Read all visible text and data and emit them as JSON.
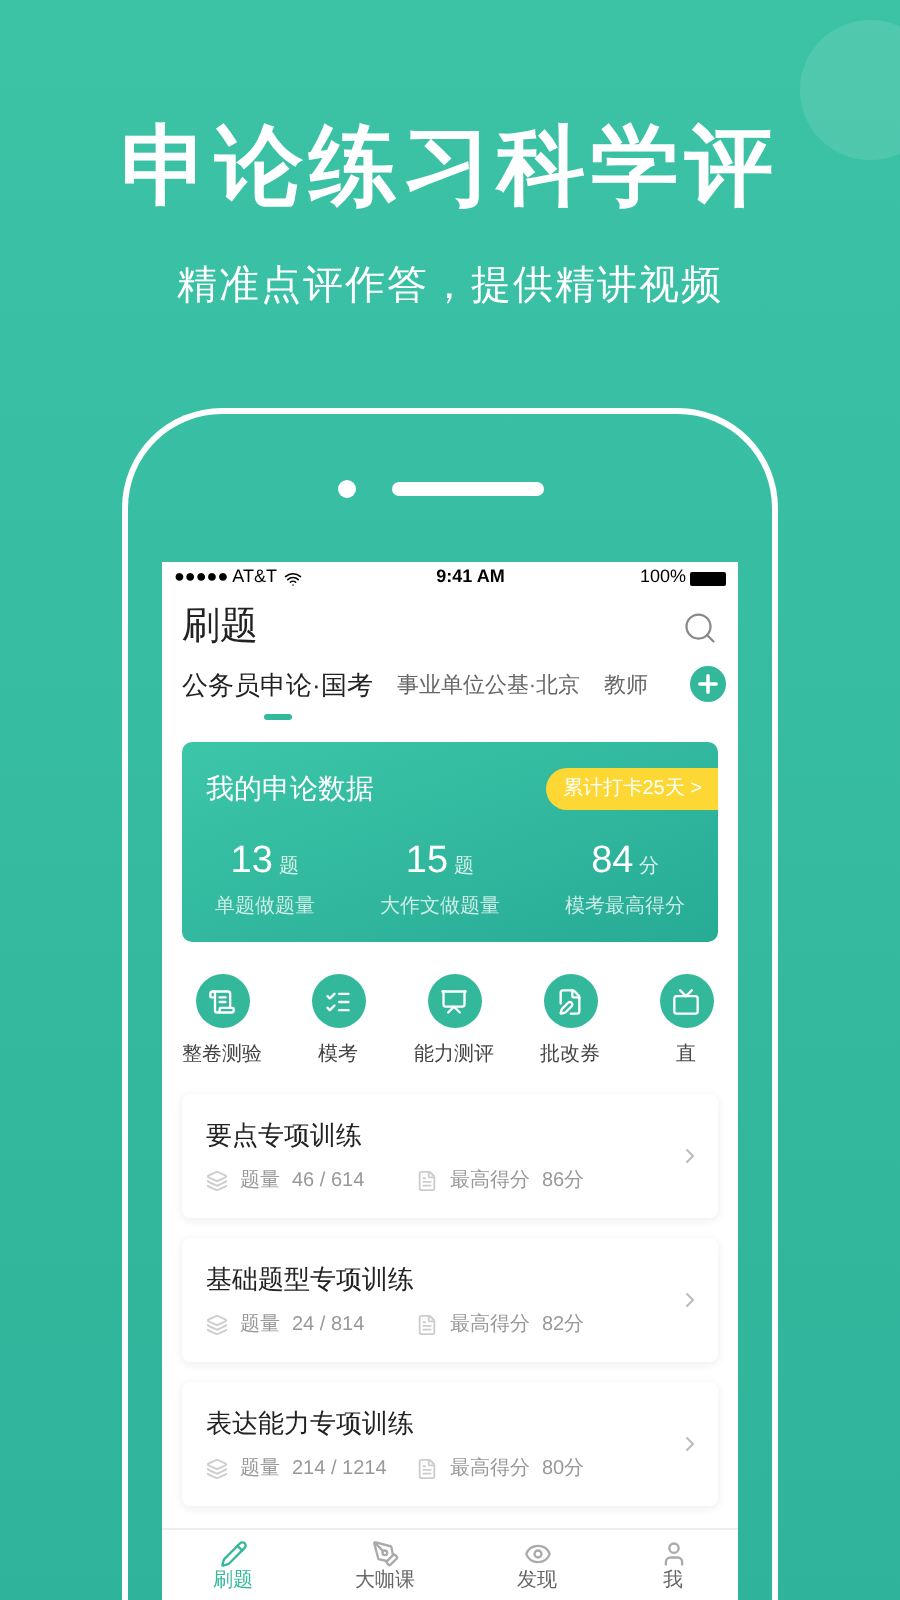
{
  "headline": "申论练习科学评",
  "subtitle": "精准点评作答，提供精讲视频",
  "status_bar": {
    "carrier": "●●●●● AT&T",
    "time": "9:41 AM",
    "battery": "100%"
  },
  "page_title": "刷题",
  "tabs": [
    {
      "label": "公务员申论·国考",
      "selected": true
    },
    {
      "label": "事业单位公基·北京",
      "selected": false
    },
    {
      "label": "教师",
      "selected": false
    }
  ],
  "data_card": {
    "title": "我的申论数据",
    "badge": "累计打卡25天 >",
    "stats": [
      {
        "value": "13",
        "unit": "题",
        "label": "单题做题量"
      },
      {
        "value": "15",
        "unit": "题",
        "label": "大作文做题量"
      },
      {
        "value": "84",
        "unit": "分",
        "label": "模考最高得分"
      }
    ]
  },
  "shortcuts": [
    {
      "label": "整卷测验"
    },
    {
      "label": "模考"
    },
    {
      "label": "能力测评"
    },
    {
      "label": "批改券"
    },
    {
      "label": "直"
    }
  ],
  "courses": [
    {
      "title": "要点专项训练",
      "count_label": "题量",
      "count": "46 / 614",
      "score_label": "最高得分",
      "score": "86分"
    },
    {
      "title": "基础题型专项训练",
      "count_label": "题量",
      "count": "24 / 814",
      "score_label": "最高得分",
      "score": "82分"
    },
    {
      "title": "表达能力专项训练",
      "count_label": "题量",
      "count": "214 / 1214",
      "score_label": "最高得分",
      "score": "80分"
    }
  ],
  "bottom_nav": [
    {
      "label": "刷题",
      "selected": true
    },
    {
      "label": "大咖课",
      "selected": false
    },
    {
      "label": "发现",
      "selected": false
    },
    {
      "label": "我",
      "selected": false
    }
  ]
}
